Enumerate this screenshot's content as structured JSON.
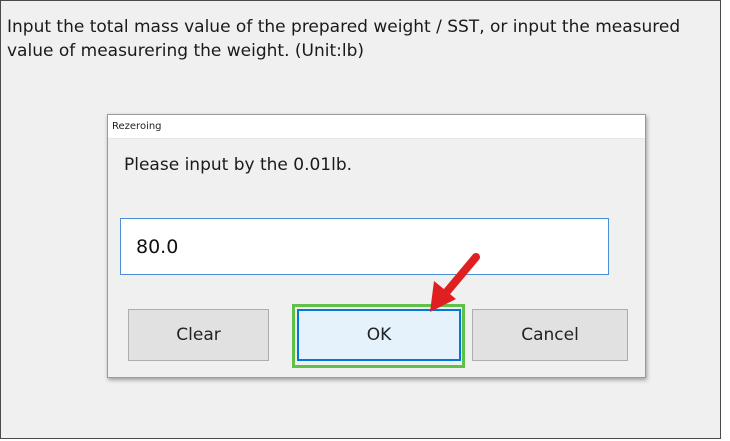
{
  "instruction": {
    "text": "Input the total mass value of the prepared weight / SST, or input the measured value of measurering the weight. (Unit:lb)"
  },
  "dialog": {
    "title": "Rezeroing",
    "prompt": "Please input by the 0.01lb.",
    "input_value": "80.0",
    "buttons": {
      "clear": "Clear",
      "ok": "OK",
      "cancel": "Cancel"
    }
  },
  "annotations": {
    "highlight_color": "#5fc04a",
    "arrow_color": "#e02020",
    "arrow_icon": "red-arrow-icon"
  },
  "colors": {
    "focus_border": "#0078d7",
    "background": "#f0f0f0"
  }
}
